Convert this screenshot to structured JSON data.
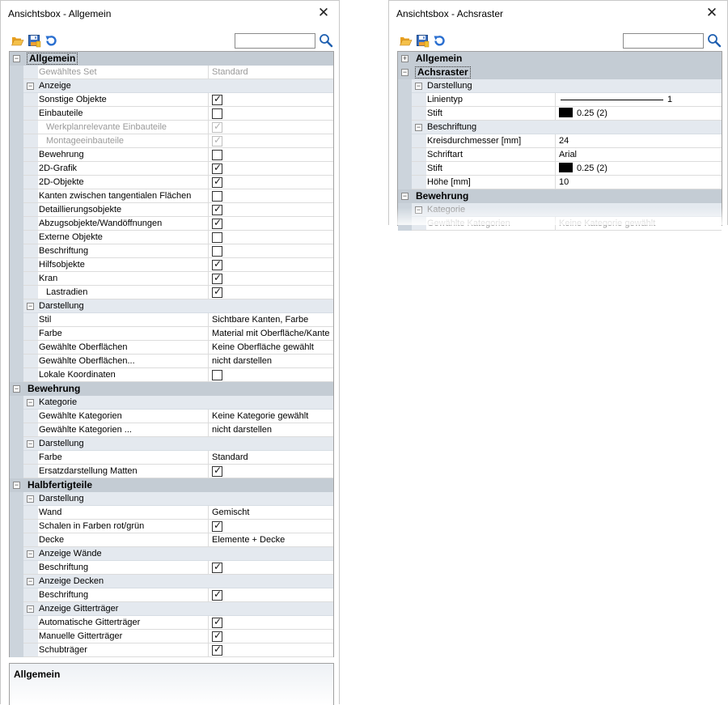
{
  "left_window": {
    "title": "Ansichtsbox - Allgemein",
    "search_value": "",
    "sections": [
      {
        "label": "Allgemein",
        "expanded": true,
        "selected": true,
        "rows": [
          {
            "kind": "prop",
            "name": "Gewähltes Set",
            "value": "Standard",
            "disabled": true
          },
          {
            "kind": "sub",
            "label": "Anzeige"
          },
          {
            "kind": "check",
            "name": "Sonstige Objekte",
            "checked": true
          },
          {
            "kind": "check",
            "name": "Einbauteile",
            "checked": false
          },
          {
            "kind": "check",
            "name": "Werkplanrelevante Einbauteile",
            "checked": true,
            "disabled": true,
            "deep": true
          },
          {
            "kind": "check",
            "name": "Montageeinbauteile",
            "checked": true,
            "disabled": true,
            "deep": true
          },
          {
            "kind": "check",
            "name": "Bewehrung",
            "checked": false
          },
          {
            "kind": "check",
            "name": "2D-Grafik",
            "checked": true
          },
          {
            "kind": "check",
            "name": "2D-Objekte",
            "checked": true
          },
          {
            "kind": "check",
            "name": "Kanten zwischen tangentialen Flächen",
            "checked": false
          },
          {
            "kind": "check",
            "name": "Detaillierungsobjekte",
            "checked": true
          },
          {
            "kind": "check",
            "name": "Abzugsobjekte/Wandöffnungen",
            "checked": true
          },
          {
            "kind": "check",
            "name": "Externe Objekte",
            "checked": false
          },
          {
            "kind": "check",
            "name": "Beschriftung",
            "checked": false
          },
          {
            "kind": "check",
            "name": "Hilfsobjekte",
            "checked": true
          },
          {
            "kind": "check",
            "name": "Kran",
            "checked": true
          },
          {
            "kind": "check",
            "name": "Lastradien",
            "checked": true,
            "deep": true
          },
          {
            "kind": "sub",
            "label": "Darstellung"
          },
          {
            "kind": "prop",
            "name": "Stil",
            "value": "Sichtbare Kanten, Farbe"
          },
          {
            "kind": "prop",
            "name": "Farbe",
            "value": "Material mit Oberfläche/Kante"
          },
          {
            "kind": "prop",
            "name": "Gewählte Oberflächen",
            "value": "Keine Oberfläche gewählt"
          },
          {
            "kind": "prop",
            "name": "Gewählte Oberflächen...",
            "value": "nicht darstellen"
          },
          {
            "kind": "check",
            "name": "Lokale Koordinaten",
            "checked": false
          }
        ]
      },
      {
        "label": "Bewehrung",
        "expanded": true,
        "rows": [
          {
            "kind": "sub",
            "label": "Kategorie"
          },
          {
            "kind": "prop",
            "name": "Gewählte Kategorien",
            "value": "Keine Kategorie gewählt"
          },
          {
            "kind": "prop",
            "name": "Gewählte Kategorien ...",
            "value": "nicht darstellen"
          },
          {
            "kind": "sub",
            "label": "Darstellung"
          },
          {
            "kind": "prop",
            "name": "Farbe",
            "value": "Standard"
          },
          {
            "kind": "check",
            "name": "Ersatzdarstellung Matten",
            "checked": true
          }
        ]
      },
      {
        "label": "Halbfertigteile",
        "expanded": true,
        "rows": [
          {
            "kind": "sub",
            "label": "Darstellung"
          },
          {
            "kind": "prop",
            "name": "Wand",
            "value": "Gemischt"
          },
          {
            "kind": "check",
            "name": "Schalen in Farben rot/grün",
            "checked": true
          },
          {
            "kind": "prop",
            "name": "Decke",
            "value": "Elemente + Decke"
          },
          {
            "kind": "sub",
            "label": "Anzeige Wände"
          },
          {
            "kind": "check",
            "name": "Beschriftung",
            "checked": true
          },
          {
            "kind": "sub",
            "label": "Anzeige Decken"
          },
          {
            "kind": "check",
            "name": "Beschriftung",
            "checked": true
          },
          {
            "kind": "sub",
            "label": "Anzeige Gitterträger"
          },
          {
            "kind": "check",
            "name": "Automatische Gitterträger",
            "checked": true
          },
          {
            "kind": "check",
            "name": "Manuelle Gitterträger",
            "checked": true
          },
          {
            "kind": "check",
            "name": "Schubträger",
            "checked": true
          }
        ]
      }
    ],
    "description_title": "Allgemein"
  },
  "right_window": {
    "title": "Ansichtsbox - Achsraster",
    "search_value": "",
    "sections": [
      {
        "label": "Allgemein",
        "expanded": false,
        "rows": []
      },
      {
        "label": "Achsraster",
        "expanded": true,
        "selected": true,
        "rows": [
          {
            "kind": "sub",
            "label": "Darstellung"
          },
          {
            "kind": "line",
            "name": "Linientyp",
            "value": "1"
          },
          {
            "kind": "pen",
            "name": "Stift",
            "value": "0.25 (2)"
          },
          {
            "kind": "sub",
            "label": "Beschriftung"
          },
          {
            "kind": "prop",
            "name": "Kreisdurchmesser [mm]",
            "value": "24"
          },
          {
            "kind": "prop",
            "name": "Schriftart",
            "value": "Arial"
          },
          {
            "kind": "pen",
            "name": "Stift",
            "value": "0.25 (2)"
          },
          {
            "kind": "prop",
            "name": "Höhe [mm]",
            "value": "10"
          }
        ]
      },
      {
        "label": "Bewehrung",
        "expanded": true,
        "rows": [
          {
            "kind": "sub",
            "label": "Kategorie",
            "disabled": true
          },
          {
            "kind": "prop",
            "name": "Gewählte Kategorien",
            "value": "Keine Kategorie gewählt",
            "disabled": true
          }
        ]
      }
    ]
  },
  "icons": {
    "open": "folder-open-icon",
    "save": "save-icon",
    "reset": "undo-icon",
    "search": "magnifier-icon",
    "close": "close-icon"
  },
  "colors": {
    "category_bg": "#c4ccd4",
    "subcategory_bg": "#e4e9ef",
    "grid_line": "#dcdcdc"
  }
}
